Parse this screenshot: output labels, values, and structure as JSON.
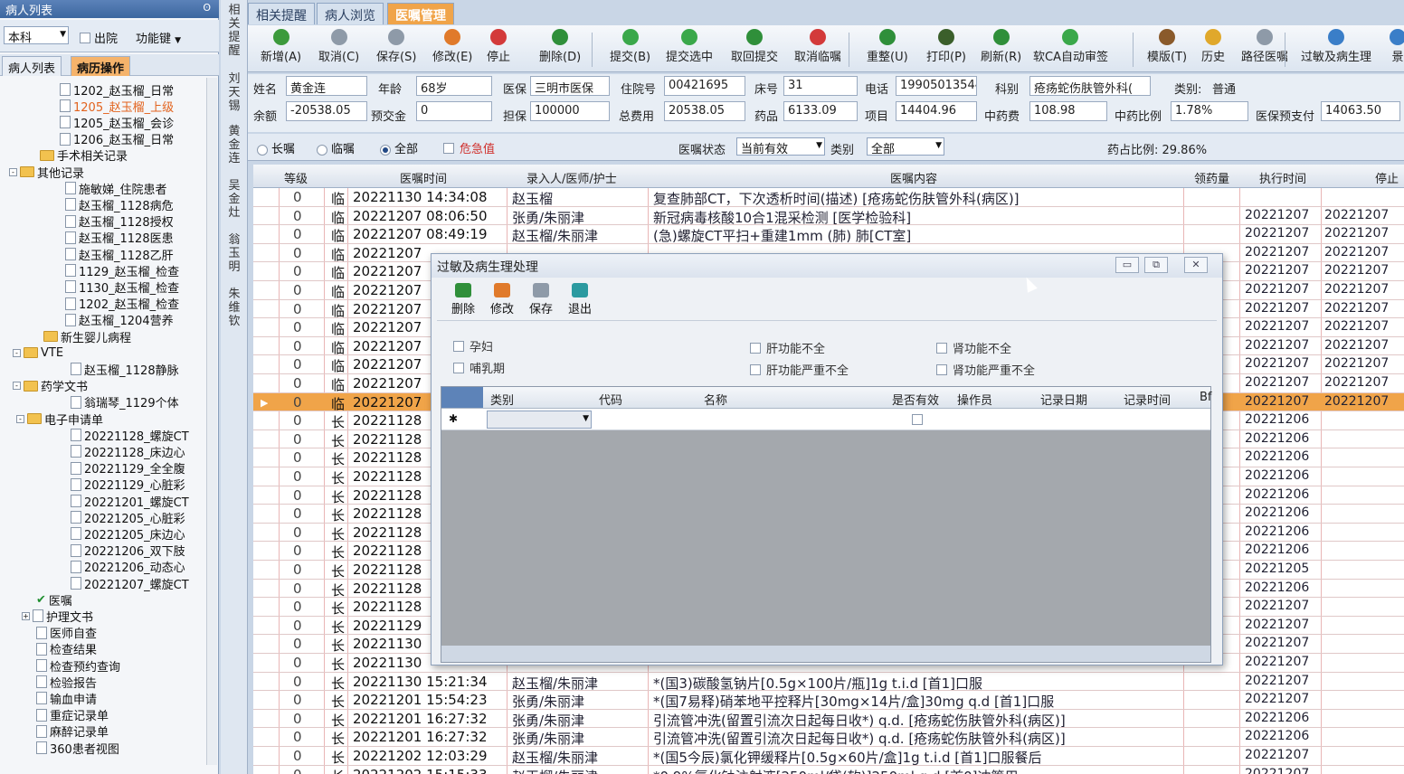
{
  "left_panel": {
    "title": "病人列表",
    "pin": "ʘ",
    "dept": "本科",
    "discharge_label": "出院",
    "function_label": "功能键",
    "tabs": [
      "病人列表",
      "病历操作"
    ],
    "tree": [
      {
        "label": "1202_赵玉榴_日常",
        "kind": "doc",
        "indent": 80,
        "selected": false
      },
      {
        "label": "1205_赵玉榴_上级",
        "kind": "doc",
        "indent": 80,
        "selected": true
      },
      {
        "label": "1205_赵玉榴_会诊",
        "kind": "doc",
        "indent": 80,
        "selected": false
      },
      {
        "label": "1206_赵玉榴_日常",
        "kind": "doc",
        "indent": 80,
        "selected": false
      },
      {
        "label": "手术相关记录",
        "kind": "folder",
        "indent": 58,
        "selected": false
      },
      {
        "label": "其他记录",
        "kind": "folder",
        "indent": 40,
        "expander": "-",
        "selected": false
      },
      {
        "label": "施敏娣_住院患者",
        "kind": "doc",
        "indent": 86,
        "selected": false
      },
      {
        "label": "赵玉榴_1128病危",
        "kind": "doc",
        "indent": 86,
        "selected": false
      },
      {
        "label": "赵玉榴_1128授权",
        "kind": "doc",
        "indent": 86,
        "selected": false
      },
      {
        "label": "赵玉榴_1128医患",
        "kind": "doc",
        "indent": 86,
        "selected": false
      },
      {
        "label": "赵玉榴_1128乙肝",
        "kind": "doc",
        "indent": 86,
        "selected": false
      },
      {
        "label": "1129_赵玉榴_检查",
        "kind": "doc",
        "indent": 86,
        "selected": false
      },
      {
        "label": "1130_赵玉榴_检查",
        "kind": "doc",
        "indent": 86,
        "selected": false
      },
      {
        "label": "1202_赵玉榴_检查",
        "kind": "doc",
        "indent": 86,
        "selected": false
      },
      {
        "label": "赵玉榴_1204营养",
        "kind": "doc",
        "indent": 86,
        "selected": false
      },
      {
        "label": "新生婴儿病程",
        "kind": "folder",
        "indent": 62,
        "selected": false
      },
      {
        "label": "VTE",
        "kind": "folder",
        "indent": 44,
        "expander": "-",
        "selected": false
      },
      {
        "label": "赵玉榴_1128静脉",
        "kind": "doc",
        "indent": 92,
        "selected": false
      },
      {
        "label": "药学文书",
        "kind": "folder",
        "indent": 44,
        "expander": "-",
        "selected": false
      },
      {
        "label": "翁瑞琴_1129个体",
        "kind": "doc",
        "indent": 92,
        "selected": false
      },
      {
        "label": "电子申请单",
        "kind": "folder",
        "indent": 48,
        "expander": "-",
        "selected": false
      },
      {
        "label": "20221128_螺旋CT",
        "kind": "doc",
        "indent": 92,
        "selected": false
      },
      {
        "label": "20221128_床边心",
        "kind": "doc",
        "indent": 92,
        "selected": false
      },
      {
        "label": "20221129_全全腹",
        "kind": "doc",
        "indent": 92,
        "selected": false
      },
      {
        "label": "20221129_心脏彩",
        "kind": "doc",
        "indent": 92,
        "selected": false
      },
      {
        "label": "20221201_螺旋CT",
        "kind": "doc",
        "indent": 92,
        "selected": false
      },
      {
        "label": "20221205_心脏彩",
        "kind": "doc",
        "indent": 92,
        "selected": false
      },
      {
        "label": "20221205_床边心",
        "kind": "doc",
        "indent": 92,
        "selected": false
      },
      {
        "label": "20221206_双下肢",
        "kind": "doc",
        "indent": 92,
        "selected": false
      },
      {
        "label": "20221206_动态心",
        "kind": "doc",
        "indent": 92,
        "selected": false
      },
      {
        "label": "20221207_螺旋CT",
        "kind": "doc",
        "indent": 92,
        "selected": false
      },
      {
        "label": "医嘱",
        "kind": "check",
        "indent": 54,
        "selected": false
      },
      {
        "label": "护理文书",
        "kind": "doc",
        "indent": 54,
        "expander": "+",
        "selected": false
      },
      {
        "label": "医师自查",
        "kind": "doc",
        "indent": 54,
        "selected": false
      },
      {
        "label": "检查结果",
        "kind": "doc",
        "indent": 54,
        "selected": false
      },
      {
        "label": "检查预约查询",
        "kind": "doc",
        "indent": 54,
        "selected": false
      },
      {
        "label": "检验报告",
        "kind": "doc",
        "indent": 54,
        "selected": false
      },
      {
        "label": "输血申请",
        "kind": "doc",
        "indent": 54,
        "selected": false
      },
      {
        "label": "重症记录单",
        "kind": "doc",
        "indent": 54,
        "selected": false
      },
      {
        "label": "麻醉记录单",
        "kind": "doc",
        "indent": 54,
        "selected": false
      },
      {
        "label": "360患者视图",
        "kind": "doc",
        "indent": 54,
        "selected": false
      }
    ]
  },
  "vertical_strip": [
    {
      "text": "相关提醒"
    },
    {
      "text": "刘天锡"
    },
    {
      "text": "黄金连"
    },
    {
      "text": "吴金灶"
    },
    {
      "text": "翁玉明"
    },
    {
      "text": "朱维钦"
    }
  ],
  "tabs": [
    "相关提醒",
    "病人浏览",
    "医嘱管理"
  ],
  "toolbar": [
    {
      "label": "新增(A)",
      "icon": "add-icon",
      "color": "#3c9a3c"
    },
    {
      "label": "取消(C)",
      "icon": "undo-icon",
      "color": "#8e9aa8"
    },
    {
      "label": "保存(S)",
      "icon": "save-icon",
      "color": "#8e9aa8"
    },
    {
      "label": "修改(E)",
      "icon": "edit-icon",
      "color": "#e07a2b"
    },
    {
      "label": "停止",
      "icon": "stop-icon",
      "color": "#d33a3a"
    },
    {
      "label": "删除(D)",
      "icon": "delete-icon",
      "color": "#2f8f3a"
    },
    {
      "label": "提交(B)",
      "icon": "submit-icon",
      "color": "#3aa84a"
    },
    {
      "label": "提交选中",
      "icon": "submit-selected-icon",
      "color": "#3aa84a"
    },
    {
      "label": "取回提交",
      "icon": "retrieve-icon",
      "color": "#2f8f3a"
    },
    {
      "label": "取消临嘱",
      "icon": "cancel-temp-icon",
      "color": "#d33a3a"
    },
    {
      "label": "重整(U)",
      "icon": "reorganize-icon",
      "color": "#2f8f3a"
    },
    {
      "label": "打印(P)",
      "icon": "print-icon",
      "color": "#3b5f2b"
    },
    {
      "label": "刷新(R)",
      "icon": "refresh-icon",
      "color": "#2f8f3a"
    },
    {
      "label": "软CA自动审签",
      "icon": "ca-sign-icon",
      "color": "#3aa84a"
    },
    {
      "label": "模版(T)",
      "icon": "template-icon",
      "color": "#8a5a2b"
    },
    {
      "label": "历史",
      "icon": "history-icon",
      "color": "#e0a82b"
    },
    {
      "label": "路径医嘱",
      "icon": "pathway-icon",
      "color": "#8e9aa8"
    },
    {
      "label": "过敏及病生理",
      "icon": "allergy-icon",
      "color": "#3a7ec8"
    },
    {
      "label": "景",
      "icon": "more-icon",
      "color": "#3a7ec8"
    }
  ],
  "patient": {
    "name_label": "姓名",
    "name": "黄金连",
    "age_label": "年龄",
    "age": "68岁",
    "insurance_label": "医保",
    "insurance": "三明市医保",
    "admission_label": "住院号",
    "admission": "00421695",
    "bed_label": "床号",
    "bed": "31",
    "phone_label": "电话",
    "phone": "19905013544",
    "dept_label": "科别",
    "dept": "疮疡蛇伤肤管外科(",
    "category_label": "类别:",
    "category": "普通",
    "balance_label": "余额",
    "balance": "-20538.05",
    "prepay_label": "预交金",
    "prepay": "0",
    "guarantee_label": "担保",
    "guarantee": "100000",
    "total_label": "总费用",
    "total": "20538.05",
    "drug_label": "药品",
    "drug": "6133.09",
    "item_label": "项目",
    "item": "14404.96",
    "herbal_label": "中药费",
    "herbal": "108.98",
    "herbal_ratio_label": "中药比例",
    "herbal_ratio": "1.78%",
    "ins_prepay_label": "医保预支付",
    "ins_prepay": "14063.50"
  },
  "filter": {
    "long_label": "长嘱",
    "temp_label": "临嘱",
    "all_label": "全部",
    "critical_label": "危急值",
    "status_label": "医嘱状态",
    "status_value": "当前有效",
    "type_label": "类别",
    "type_value": "全部",
    "drug_ratio": "药占比例: 29.86%"
  },
  "grid": {
    "headers": {
      "level": "等级",
      "time": "医嘱时间",
      "who": "录入人/医师/护士",
      "content": "医嘱内容",
      "dispense": "领药量",
      "exec": "执行时间",
      "stop": "停止"
    },
    "rows": [
      {
        "level": "0",
        "type": "临",
        "time": "20221130 14:34:08",
        "who": "赵玉榴",
        "content": "复查肺部CT，下次透析时间(描述)  [疮疡蛇伤肤管外科(病区)]",
        "exec": "",
        "stop": ""
      },
      {
        "level": "0",
        "type": "临",
        "time": "20221207 08:06:50",
        "who": "张勇/朱丽津",
        "content": "新冠病毒核酸10合1混采检测    [医学检验科]",
        "exec": "20221207",
        "stop": "20221207"
      },
      {
        "level": "0",
        "type": "临",
        "time": "20221207 08:49:19",
        "who": "赵玉榴/朱丽津",
        "content": "(急)螺旋CT平扫+重建1mm (肺)    肺[CT室]",
        "exec": "20221207",
        "stop": "20221207"
      },
      {
        "level": "0",
        "type": "临",
        "time": "20221207",
        "who": "",
        "content": "",
        "exec": "20221207",
        "stop": "20221207"
      },
      {
        "level": "0",
        "type": "临",
        "time": "20221207",
        "who": "",
        "content": "",
        "exec": "20221207",
        "stop": "20221207"
      },
      {
        "level": "0",
        "type": "临",
        "time": "20221207",
        "who": "",
        "content": "",
        "exec": "20221207",
        "stop": "20221207"
      },
      {
        "level": "0",
        "type": "临",
        "time": "20221207",
        "who": "",
        "content": "",
        "exec": "20221207",
        "stop": "20221207"
      },
      {
        "level": "0",
        "type": "临",
        "time": "20221207",
        "who": "",
        "content": "",
        "exec": "20221207",
        "stop": "20221207"
      },
      {
        "level": "0",
        "type": "临",
        "time": "20221207",
        "who": "",
        "content": "",
        "exec": "20221207",
        "stop": "20221207"
      },
      {
        "level": "0",
        "type": "临",
        "time": "20221207",
        "who": "",
        "content": "",
        "exec": "20221207",
        "stop": "20221207"
      },
      {
        "level": "0",
        "type": "临",
        "time": "20221207",
        "who": "",
        "content": "",
        "exec": "20221207",
        "stop": "20221207"
      },
      {
        "level": "0",
        "type": "临",
        "time": "20221207",
        "who": "",
        "content": "",
        "exec": "20221207",
        "stop": "20221207",
        "selected": true
      },
      {
        "level": "0",
        "type": "长",
        "time": "20221128",
        "who": "",
        "content": "",
        "exec": "20221206",
        "stop": ""
      },
      {
        "level": "0",
        "type": "长",
        "time": "20221128",
        "who": "",
        "content": "",
        "exec": "20221206",
        "stop": ""
      },
      {
        "level": "0",
        "type": "长",
        "time": "20221128",
        "who": "",
        "content": "",
        "exec": "20221206",
        "stop": ""
      },
      {
        "level": "0",
        "type": "长",
        "time": "20221128",
        "who": "",
        "content": "",
        "exec": "20221206",
        "stop": ""
      },
      {
        "level": "0",
        "type": "长",
        "time": "20221128",
        "who": "",
        "content": "",
        "exec": "20221206",
        "stop": ""
      },
      {
        "level": "0",
        "type": "长",
        "time": "20221128",
        "who": "",
        "content": "",
        "exec": "20221206",
        "stop": ""
      },
      {
        "level": "0",
        "type": "长",
        "time": "20221128",
        "who": "",
        "content": "",
        "exec": "20221206",
        "stop": ""
      },
      {
        "level": "0",
        "type": "长",
        "time": "20221128",
        "who": "",
        "content": "",
        "exec": "20221206",
        "stop": ""
      },
      {
        "level": "0",
        "type": "长",
        "time": "20221128",
        "who": "",
        "content": "",
        "exec": "20221205",
        "stop": ""
      },
      {
        "level": "0",
        "type": "长",
        "time": "20221128",
        "who": "",
        "content": "",
        "exec": "20221206",
        "stop": ""
      },
      {
        "level": "0",
        "type": "长",
        "time": "20221128",
        "who": "",
        "content": "",
        "exec": "20221207",
        "stop": ""
      },
      {
        "level": "0",
        "type": "长",
        "time": "20221129",
        "who": "",
        "content": "",
        "exec": "20221207",
        "stop": ""
      },
      {
        "level": "0",
        "type": "长",
        "time": "20221130",
        "who": "",
        "content": "",
        "exec": "20221207",
        "stop": ""
      },
      {
        "level": "0",
        "type": "长",
        "time": "20221130",
        "who": "",
        "content": "",
        "exec": "20221207",
        "stop": ""
      },
      {
        "level": "0",
        "type": "长",
        "time": "20221130 15:21:34",
        "who": "赵玉榴/朱丽津",
        "content": "*(国3)碳酸氢钠片[0.5g×100片/瓶]1g t.i.d [首1]口服",
        "exec": "20221207",
        "stop": ""
      },
      {
        "level": "0",
        "type": "长",
        "time": "20221201 15:54:23",
        "who": "张勇/朱丽津",
        "content": "*(国7易释)硝苯地平控释片[30mg×14片/盒]30mg q.d [首1]口服",
        "exec": "20221207",
        "stop": ""
      },
      {
        "level": "0",
        "type": "长",
        "time": "20221201 16:27:32",
        "who": "张勇/朱丽津",
        "content": "引流管冲洗(留置引流次日起每日收*)  q.d. [疮疡蛇伤肤管外科(病区)]",
        "exec": "20221206",
        "stop": ""
      },
      {
        "level": "0",
        "type": "长",
        "time": "20221201 16:27:32",
        "who": "张勇/朱丽津",
        "content": "引流管冲洗(留置引流次日起每日收*)  q.d. [疮疡蛇伤肤管外科(病区)]",
        "exec": "20221206",
        "stop": ""
      },
      {
        "level": "0",
        "type": "长",
        "time": "20221202 12:03:29",
        "who": "赵玉榴/朱丽津",
        "content": "*(国5今辰)氯化钾缓释片[0.5g×60片/盒]1g t.i.d [首1]口服餐后",
        "exec": "20221207",
        "stop": ""
      },
      {
        "level": "0",
        "type": "长",
        "time": "20221202 15:15:33",
        "who": "赵玉榴/朱丽津",
        "content": "*0.9%氯化钠注射液[250ml/袋(软)]250ml q.d [首0]冲管用",
        "exec": "20221207",
        "stop": ""
      }
    ]
  },
  "dialog": {
    "title": "过敏及病生理处理",
    "win_min": "▭",
    "win_max": "⧉",
    "win_close": "✕",
    "toolbar": [
      {
        "label": "删除",
        "icon": "delete-icon",
        "color": "#2f8f3a"
      },
      {
        "label": "修改",
        "icon": "edit-icon",
        "color": "#e07a2b"
      },
      {
        "label": "保存",
        "icon": "save-icon",
        "color": "#8e9aa8"
      },
      {
        "label": "退出",
        "icon": "exit-icon",
        "color": "#2b9aa0"
      }
    ],
    "checks": {
      "pregnant": "孕妇",
      "lactation": "哺乳期",
      "liver_insuff": "肝功能不全",
      "liver_severe": "肝功能严重不全",
      "kidney_insuff": "肾功能不全",
      "kidney_severe": "肾功能严重不全"
    },
    "grid_headers": {
      "type": "类别",
      "code": "代码",
      "name": "名称",
      "valid": "是否有效",
      "operator": "操作员",
      "date": "记录日期",
      "time": "记录时间",
      "extra": "Bf"
    },
    "new_row_marker": "✱"
  }
}
